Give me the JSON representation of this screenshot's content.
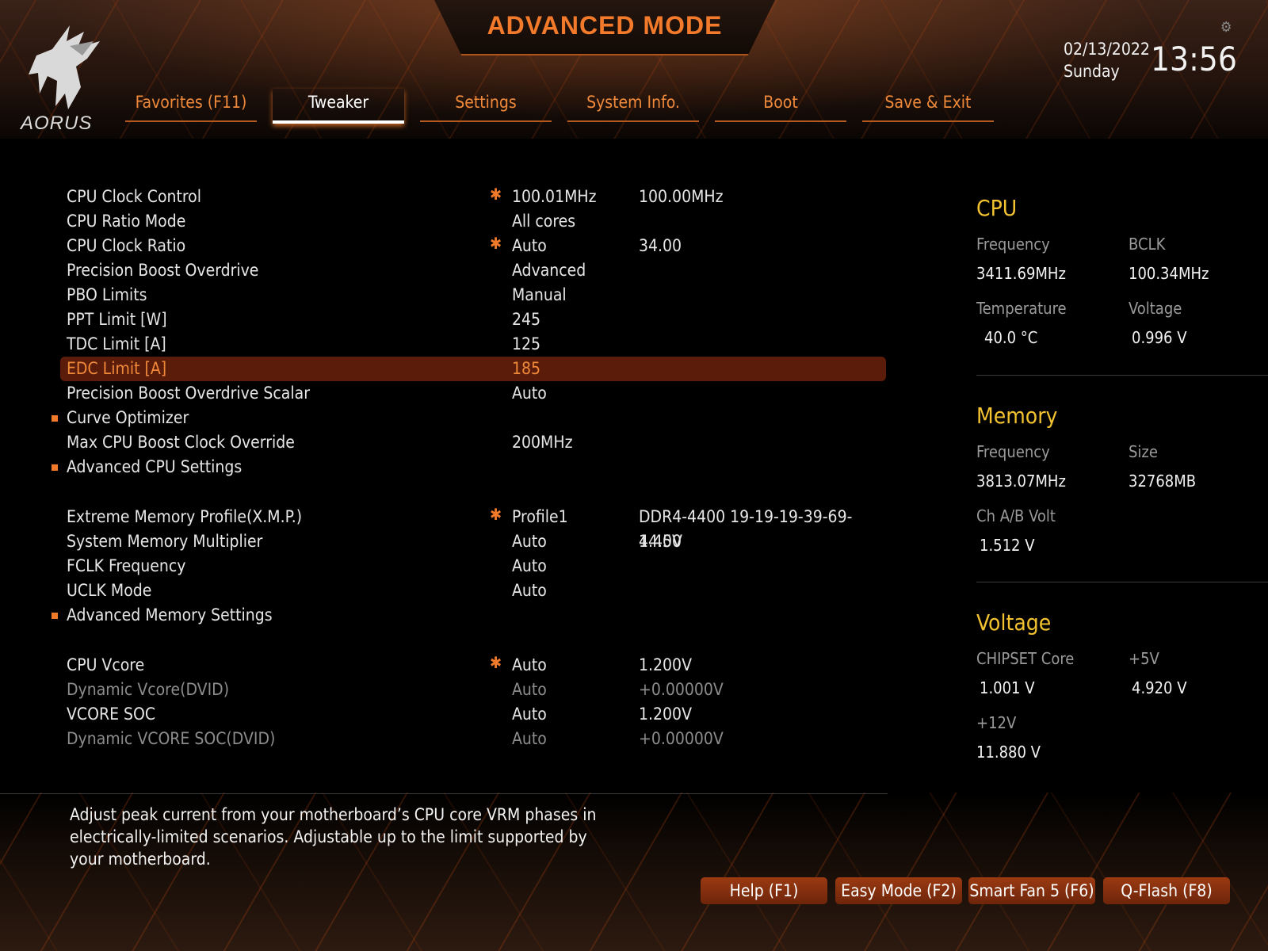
{
  "header": {
    "mode_title": "ADVANCED MODE",
    "logo_text": "AORUS",
    "date": "02/13/2022",
    "weekday": "Sunday",
    "time": "13:56"
  },
  "tabs": [
    {
      "label": "Favorites (F11)"
    },
    {
      "label": "Tweaker",
      "active": true
    },
    {
      "label": "Settings"
    },
    {
      "label": "System Info."
    },
    {
      "label": "Boot"
    },
    {
      "label": "Save & Exit"
    }
  ],
  "settings": [
    {
      "label": "CPU Clock Control",
      "value": "100.01MHz",
      "value2": "100.00MHz",
      "star": true
    },
    {
      "label": "CPU Ratio Mode",
      "value": "All cores",
      "value2": ""
    },
    {
      "label": "CPU Clock Ratio",
      "value": "Auto",
      "value2": "34.00",
      "star": true
    },
    {
      "label": "Precision Boost Overdrive",
      "value": "Advanced",
      "value2": ""
    },
    {
      "label": "PBO Limits",
      "value": "Manual",
      "value2": ""
    },
    {
      "label": "PPT Limit [W]",
      "value": "245",
      "value2": ""
    },
    {
      "label": "TDC Limit [A]",
      "value": "125",
      "value2": ""
    },
    {
      "label": "EDC Limit [A]",
      "value": "185",
      "value2": "",
      "selected": true
    },
    {
      "label": "Precision Boost Overdrive Scalar",
      "value": "Auto",
      "value2": ""
    },
    {
      "label": "Curve Optimizer",
      "value": "",
      "value2": "",
      "submenu": true
    },
    {
      "label": "Max CPU Boost Clock Override",
      "value": "200MHz",
      "value2": ""
    },
    {
      "label": "Advanced CPU Settings",
      "value": "",
      "value2": "",
      "submenu": true
    },
    {
      "label": "Extreme Memory Profile(X.M.P.)",
      "value": "Profile1",
      "value2": "DDR4-4400 19-19-19-39-69-1.45V",
      "star": true
    },
    {
      "label": "System Memory Multiplier",
      "value": "Auto",
      "value2": "44.00"
    },
    {
      "label": "FCLK Frequency",
      "value": "Auto",
      "value2": ""
    },
    {
      "label": "UCLK Mode",
      "value": "Auto",
      "value2": ""
    },
    {
      "label": "Advanced Memory Settings",
      "value": "",
      "value2": "",
      "submenu": true
    },
    {
      "label": "CPU Vcore",
      "value": "Auto",
      "value2": "1.200V",
      "star": true
    },
    {
      "label": "Dynamic Vcore(DVID)",
      "value": "Auto",
      "value2": "+0.00000V",
      "dim": true
    },
    {
      "label": "VCORE SOC",
      "value": "Auto",
      "value2": "1.200V"
    },
    {
      "label": "Dynamic VCORE SOC(DVID)",
      "value": "Auto",
      "value2": "+0.00000V",
      "dim": true
    }
  ],
  "help_text": "Adjust peak current from your motherboard’s CPU core VRM phases in electrically-limited scenarios. Adjustable up to the limit supported by your motherboard.",
  "info": {
    "cpu": {
      "title": "CPU",
      "frequency_label": "Frequency",
      "frequency": "3411.69MHz",
      "bclk_label": "BCLK",
      "bclk": "100.34MHz",
      "temperature_label": "Temperature",
      "temperature": "40.0 °C",
      "voltage_label": "Voltage",
      "voltage": "0.996 V"
    },
    "memory": {
      "title": "Memory",
      "frequency_label": "Frequency",
      "frequency": "3813.07MHz",
      "size_label": "Size",
      "size": "32768MB",
      "chab_label": "Ch A/B Volt",
      "chab": "1.512 V"
    },
    "voltage": {
      "title": "Voltage",
      "chipset_label": "CHIPSET Core",
      "chipset": "1.001 V",
      "p5v_label": "+5V",
      "p5v": "4.920 V",
      "p12v_label": "+12V",
      "p12v": "11.880 V"
    }
  },
  "footer_buttons": [
    {
      "label": "Help (F1)"
    },
    {
      "label": "Easy Mode (F2)"
    },
    {
      "label": "Smart Fan 5 (F6)"
    },
    {
      "label": "Q-Flash (F8)"
    }
  ],
  "colors": {
    "accent": "#f07a2a",
    "selected_row": "#5b1c0a",
    "section_title": "#f2c230"
  }
}
